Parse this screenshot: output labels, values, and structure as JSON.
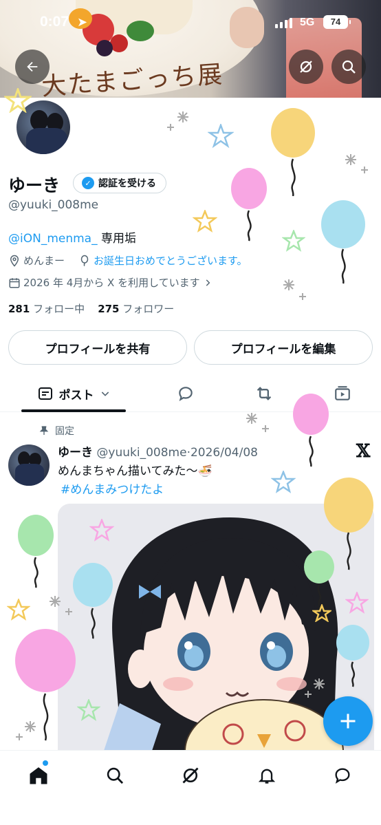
{
  "status_bar": {
    "time": "0:07",
    "network": "5G",
    "battery": "74"
  },
  "banner": {
    "plate_text": "大たまごっち展"
  },
  "profile": {
    "name": "ゆーき",
    "verify_label": "認証を受ける",
    "handle": "@yuuki_008me",
    "bio_mention": "@iON_menma_",
    "bio_text": "専用垢",
    "location": "めんまー",
    "birthday_text": "お誕生日おめでとうございます。",
    "joined": "2026 年 4月から X を利用しています",
    "following_count": "281",
    "following_label": "フォロー中",
    "followers_count": "275",
    "followers_label": "フォロワー"
  },
  "buttons": {
    "share": "プロフィールを共有",
    "edit": "プロフィールを編集"
  },
  "tabs": {
    "posts": "ポスト"
  },
  "tweet": {
    "pinned_label": "固定",
    "name": "ゆーき",
    "handle": "@yuuki_008me",
    "date": "2026/04/08",
    "text": "めんまちゃん描いてみた〜🍜",
    "hashtag": "#めんまみつけたよ"
  },
  "colors": {
    "accent": "#1d9bf0",
    "text": "#0f1419",
    "secondary": "#536471",
    "border": "#cfd9de"
  },
  "icons": [
    "back-arrow-icon",
    "grok-icon",
    "search-icon",
    "verified-badge-icon",
    "location-icon",
    "balloon-icon",
    "calendar-icon",
    "chevron-right-icon",
    "posts-icon",
    "chevron-down-icon",
    "reply-icon",
    "repost-icon",
    "media-icon",
    "pin-icon",
    "x-logo-icon",
    "home-icon",
    "search-icon",
    "grok-icon",
    "bell-icon",
    "messages-icon",
    "plus-icon"
  ]
}
